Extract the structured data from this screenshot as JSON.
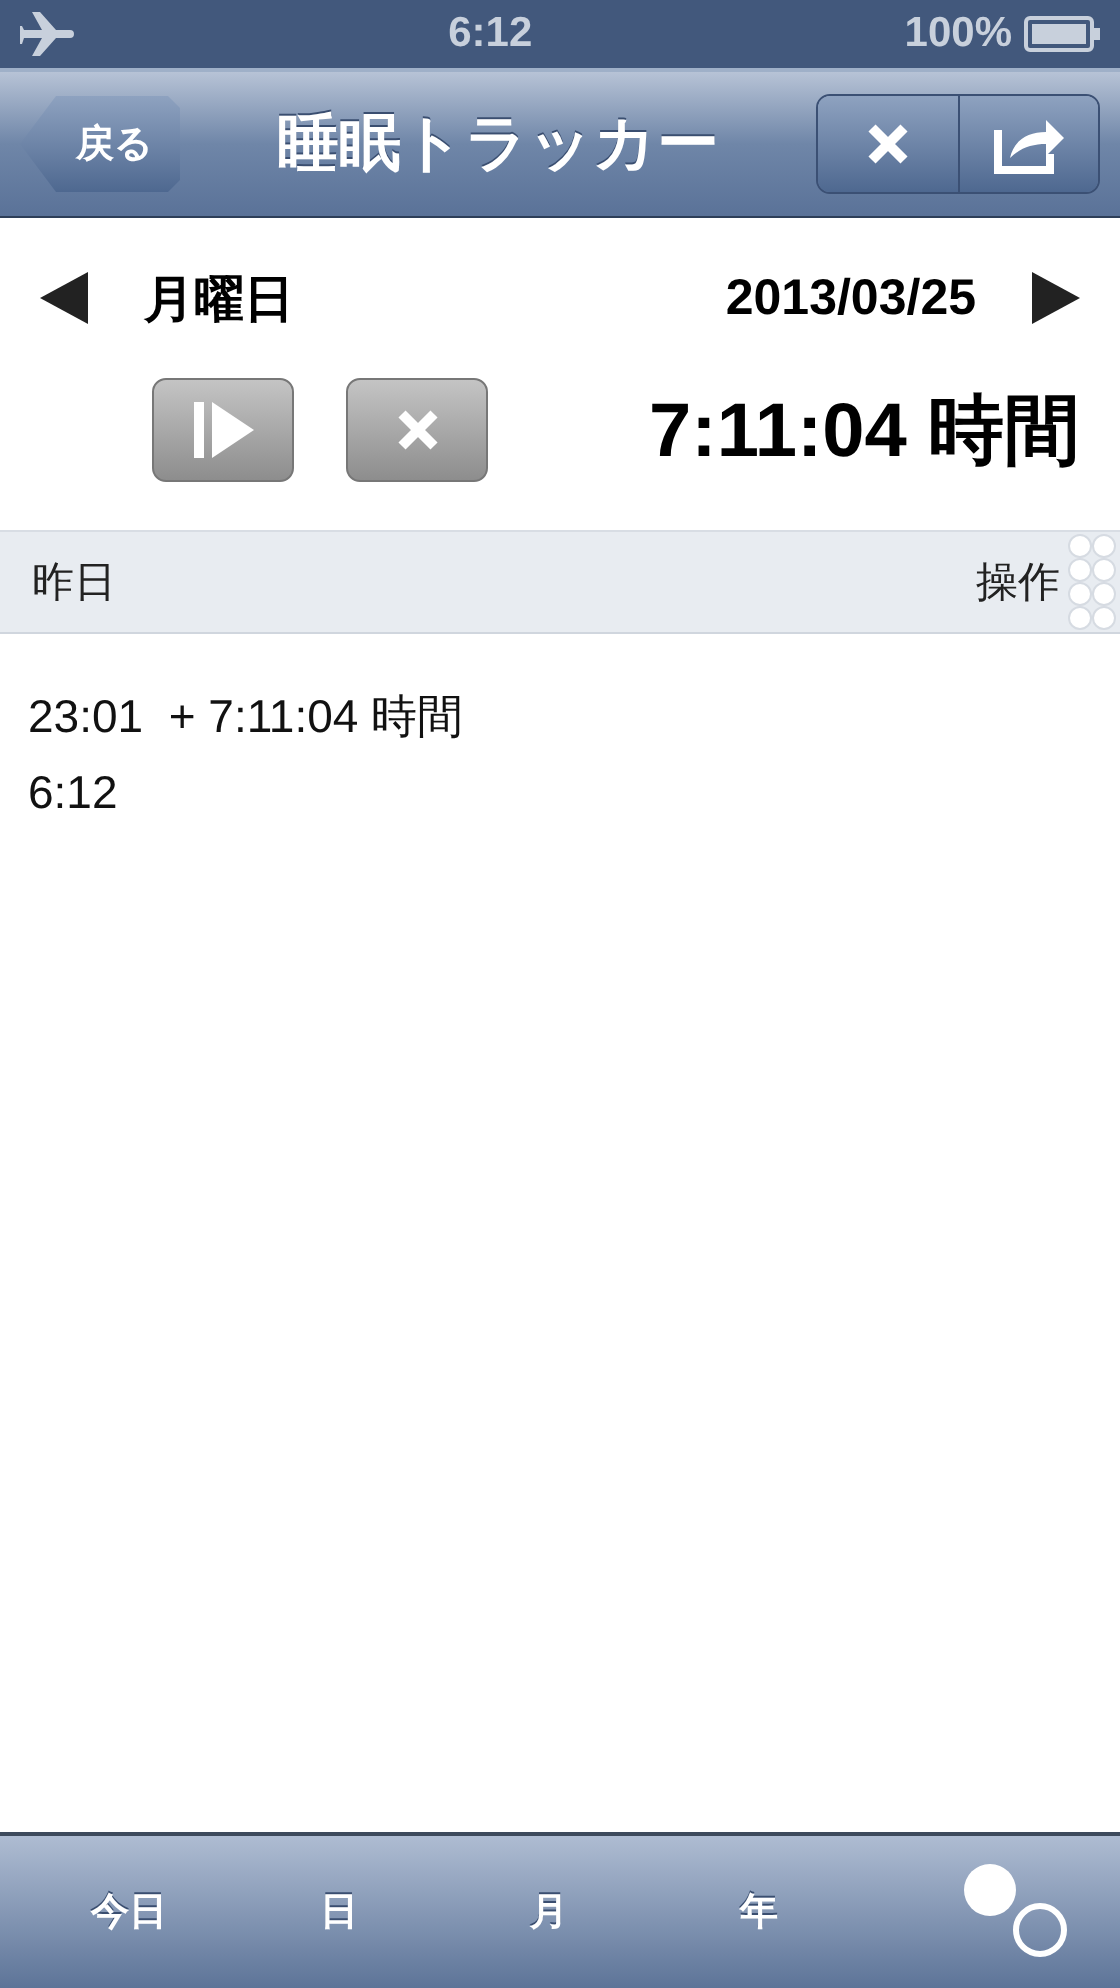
{
  "status_bar": {
    "time": "6:12",
    "battery": "100%"
  },
  "nav_bar": {
    "back": "戻る",
    "title": "睡眠トラッカー"
  },
  "day": {
    "weekday": "月曜日",
    "date": "2013/03/25",
    "total": "7:11:04 時間"
  },
  "list_header": {
    "left": "昨日",
    "right": "操作"
  },
  "entries": [
    {
      "start": "23:01",
      "duration": "+ 7:11:04 時間",
      "end": "6:12"
    }
  ],
  "toolbar": [
    "今日",
    "日",
    "月",
    "年"
  ]
}
